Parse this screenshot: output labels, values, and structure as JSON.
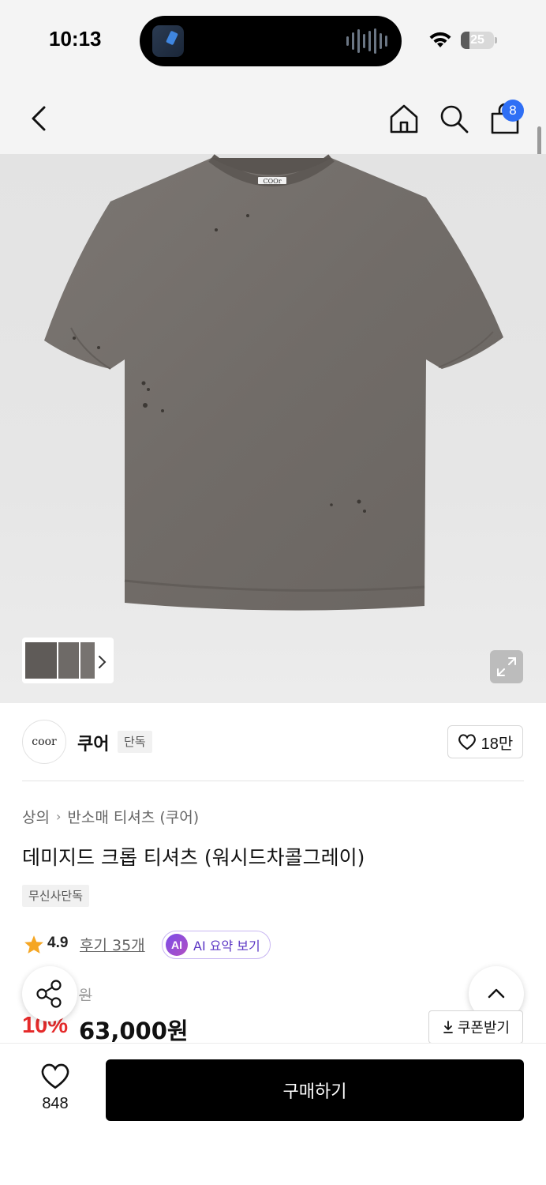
{
  "status_bar": {
    "time": "10:13",
    "battery": "25",
    "battery_level": 0.25
  },
  "nav": {
    "cart_count": "8"
  },
  "brand": {
    "logo_text": "coor",
    "name": "쿠어",
    "tag": "단독",
    "likes": "18만"
  },
  "breadcrumb": {
    "category": "상의",
    "subcategory": "반소매 티셔츠 (쿠어)"
  },
  "product": {
    "title": "데미지드 크롭 티셔츠 (워시드차콜그레이)",
    "exclusive_tag": "무신사단독",
    "label_text": "COOr",
    "rating": "4.9",
    "reviews": "후기 35개",
    "ai_badge": "AI",
    "ai_label": "AI 요약 보기",
    "original_price_suffix": "원",
    "discount": "10%",
    "price": "63,000원",
    "coupon_label": "쿠폰받기"
  },
  "bottom_bar": {
    "wish_count": "848",
    "buy_label": "구매하기"
  },
  "colors": {
    "accent_blue": "#2f6ff5",
    "discount_red": "#e52a2a",
    "star": "#f5a623",
    "ai_purple": "#7b4de8"
  }
}
